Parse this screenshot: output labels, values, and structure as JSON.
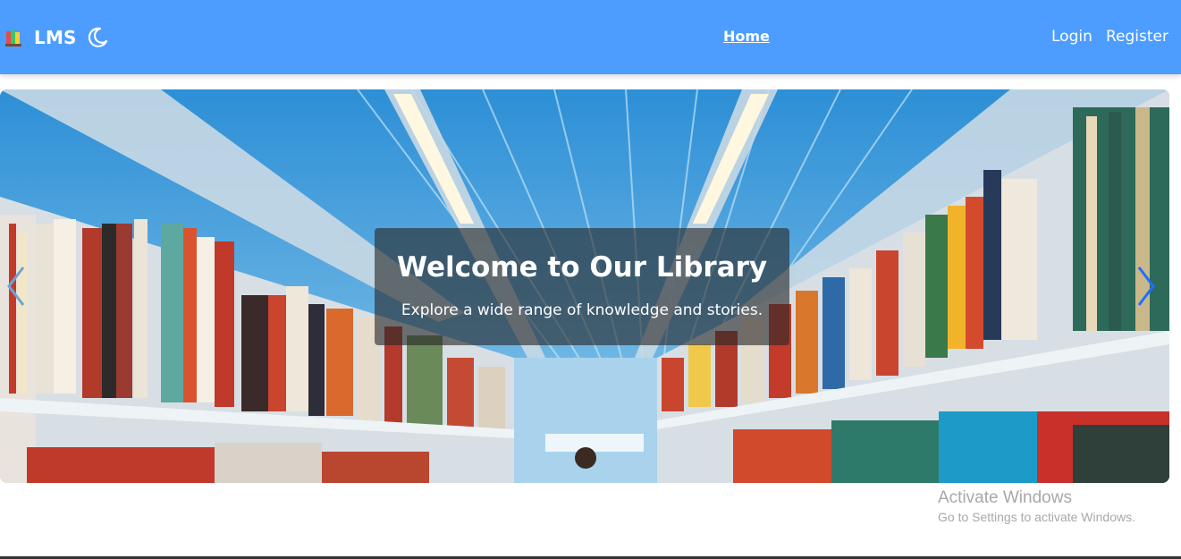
{
  "navbar": {
    "brand": "LMS",
    "links": {
      "home": "Home",
      "login": "Login",
      "register": "Register"
    },
    "bg_color": "#4c9dff"
  },
  "hero": {
    "title": "Welcome to Our Library",
    "subtitle": "Explore a wide range of knowledge and stories.",
    "image": "library-bookshelves-photo"
  },
  "watermark": {
    "title": "Activate Windows",
    "subtitle": "Go to Settings to activate Windows."
  },
  "icons": {
    "logo": "books-icon",
    "theme_toggle": "moon-icon",
    "prev": "chevron-left-icon",
    "next": "chevron-right-icon"
  }
}
